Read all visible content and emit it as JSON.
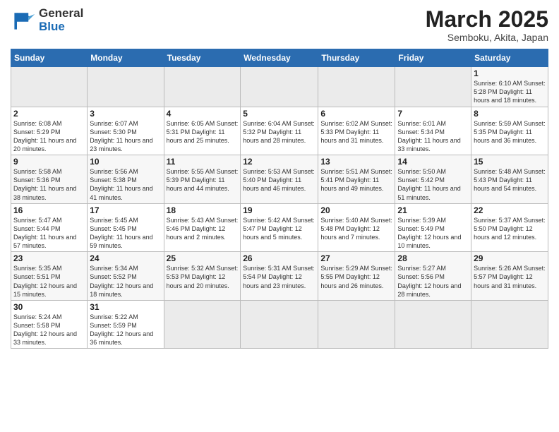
{
  "logo": {
    "line1": "General",
    "line2": "Blue"
  },
  "title": "March 2025",
  "subtitle": "Semboku, Akita, Japan",
  "days_header": [
    "Sunday",
    "Monday",
    "Tuesday",
    "Wednesday",
    "Thursday",
    "Friday",
    "Saturday"
  ],
  "weeks": [
    [
      {
        "num": "",
        "info": ""
      },
      {
        "num": "",
        "info": ""
      },
      {
        "num": "",
        "info": ""
      },
      {
        "num": "",
        "info": ""
      },
      {
        "num": "",
        "info": ""
      },
      {
        "num": "",
        "info": ""
      },
      {
        "num": "1",
        "info": "Sunrise: 6:10 AM\nSunset: 5:28 PM\nDaylight: 11 hours and 18 minutes."
      }
    ],
    [
      {
        "num": "2",
        "info": "Sunrise: 6:08 AM\nSunset: 5:29 PM\nDaylight: 11 hours and 20 minutes."
      },
      {
        "num": "3",
        "info": "Sunrise: 6:07 AM\nSunset: 5:30 PM\nDaylight: 11 hours and 23 minutes."
      },
      {
        "num": "4",
        "info": "Sunrise: 6:05 AM\nSunset: 5:31 PM\nDaylight: 11 hours and 25 minutes."
      },
      {
        "num": "5",
        "info": "Sunrise: 6:04 AM\nSunset: 5:32 PM\nDaylight: 11 hours and 28 minutes."
      },
      {
        "num": "6",
        "info": "Sunrise: 6:02 AM\nSunset: 5:33 PM\nDaylight: 11 hours and 31 minutes."
      },
      {
        "num": "7",
        "info": "Sunrise: 6:01 AM\nSunset: 5:34 PM\nDaylight: 11 hours and 33 minutes."
      },
      {
        "num": "8",
        "info": "Sunrise: 5:59 AM\nSunset: 5:35 PM\nDaylight: 11 hours and 36 minutes."
      }
    ],
    [
      {
        "num": "9",
        "info": "Sunrise: 5:58 AM\nSunset: 5:36 PM\nDaylight: 11 hours and 38 minutes."
      },
      {
        "num": "10",
        "info": "Sunrise: 5:56 AM\nSunset: 5:38 PM\nDaylight: 11 hours and 41 minutes."
      },
      {
        "num": "11",
        "info": "Sunrise: 5:55 AM\nSunset: 5:39 PM\nDaylight: 11 hours and 44 minutes."
      },
      {
        "num": "12",
        "info": "Sunrise: 5:53 AM\nSunset: 5:40 PM\nDaylight: 11 hours and 46 minutes."
      },
      {
        "num": "13",
        "info": "Sunrise: 5:51 AM\nSunset: 5:41 PM\nDaylight: 11 hours and 49 minutes."
      },
      {
        "num": "14",
        "info": "Sunrise: 5:50 AM\nSunset: 5:42 PM\nDaylight: 11 hours and 51 minutes."
      },
      {
        "num": "15",
        "info": "Sunrise: 5:48 AM\nSunset: 5:43 PM\nDaylight: 11 hours and 54 minutes."
      }
    ],
    [
      {
        "num": "16",
        "info": "Sunrise: 5:47 AM\nSunset: 5:44 PM\nDaylight: 11 hours and 57 minutes."
      },
      {
        "num": "17",
        "info": "Sunrise: 5:45 AM\nSunset: 5:45 PM\nDaylight: 11 hours and 59 minutes."
      },
      {
        "num": "18",
        "info": "Sunrise: 5:43 AM\nSunset: 5:46 PM\nDaylight: 12 hours and 2 minutes."
      },
      {
        "num": "19",
        "info": "Sunrise: 5:42 AM\nSunset: 5:47 PM\nDaylight: 12 hours and 5 minutes."
      },
      {
        "num": "20",
        "info": "Sunrise: 5:40 AM\nSunset: 5:48 PM\nDaylight: 12 hours and 7 minutes."
      },
      {
        "num": "21",
        "info": "Sunrise: 5:39 AM\nSunset: 5:49 PM\nDaylight: 12 hours and 10 minutes."
      },
      {
        "num": "22",
        "info": "Sunrise: 5:37 AM\nSunset: 5:50 PM\nDaylight: 12 hours and 12 minutes."
      }
    ],
    [
      {
        "num": "23",
        "info": "Sunrise: 5:35 AM\nSunset: 5:51 PM\nDaylight: 12 hours and 15 minutes."
      },
      {
        "num": "24",
        "info": "Sunrise: 5:34 AM\nSunset: 5:52 PM\nDaylight: 12 hours and 18 minutes."
      },
      {
        "num": "25",
        "info": "Sunrise: 5:32 AM\nSunset: 5:53 PM\nDaylight: 12 hours and 20 minutes."
      },
      {
        "num": "26",
        "info": "Sunrise: 5:31 AM\nSunset: 5:54 PM\nDaylight: 12 hours and 23 minutes."
      },
      {
        "num": "27",
        "info": "Sunrise: 5:29 AM\nSunset: 5:55 PM\nDaylight: 12 hours and 26 minutes."
      },
      {
        "num": "28",
        "info": "Sunrise: 5:27 AM\nSunset: 5:56 PM\nDaylight: 12 hours and 28 minutes."
      },
      {
        "num": "29",
        "info": "Sunrise: 5:26 AM\nSunset: 5:57 PM\nDaylight: 12 hours and 31 minutes."
      }
    ],
    [
      {
        "num": "30",
        "info": "Sunrise: 5:24 AM\nSunset: 5:58 PM\nDaylight: 12 hours and 33 minutes."
      },
      {
        "num": "31",
        "info": "Sunrise: 5:22 AM\nSunset: 5:59 PM\nDaylight: 12 hours and 36 minutes."
      },
      {
        "num": "",
        "info": ""
      },
      {
        "num": "",
        "info": ""
      },
      {
        "num": "",
        "info": ""
      },
      {
        "num": "",
        "info": ""
      },
      {
        "num": "",
        "info": ""
      }
    ]
  ]
}
